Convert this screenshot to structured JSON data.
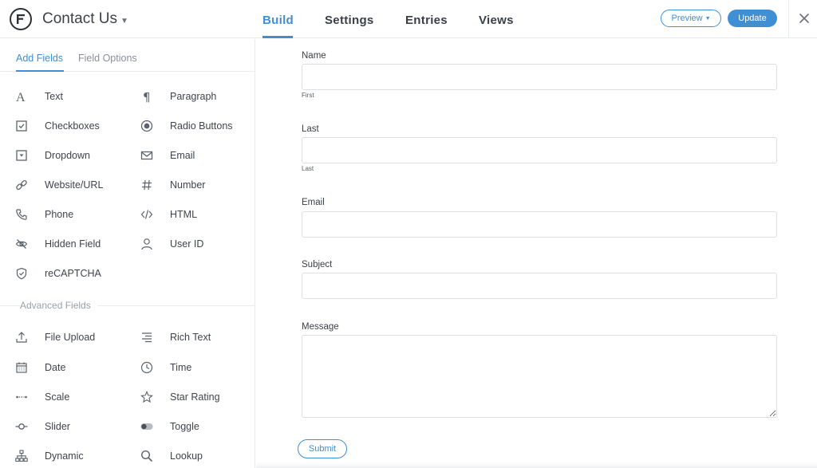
{
  "header": {
    "form_title": "Contact Us",
    "tabs": [
      {
        "label": "Build",
        "active": true
      },
      {
        "label": "Settings",
        "active": false
      },
      {
        "label": "Entries",
        "active": false
      },
      {
        "label": "Views",
        "active": false
      }
    ],
    "preview_label": "Preview",
    "update_label": "Update",
    "accent_color": "#3f8fd4"
  },
  "sidebar": {
    "tabs": [
      {
        "label": "Add Fields",
        "active": true
      },
      {
        "label": "Field Options",
        "active": false
      }
    ],
    "basic_fields": [
      {
        "label": "Text",
        "icon": "text-icon"
      },
      {
        "label": "Paragraph",
        "icon": "paragraph-icon"
      },
      {
        "label": "Checkboxes",
        "icon": "checkbox-icon"
      },
      {
        "label": "Radio Buttons",
        "icon": "radio-icon"
      },
      {
        "label": "Dropdown",
        "icon": "dropdown-icon"
      },
      {
        "label": "Email",
        "icon": "envelope-icon"
      },
      {
        "label": "Website/URL",
        "icon": "link-icon"
      },
      {
        "label": "Number",
        "icon": "hash-icon"
      },
      {
        "label": "Phone",
        "icon": "phone-icon"
      },
      {
        "label": "HTML",
        "icon": "code-icon"
      },
      {
        "label": "Hidden Field",
        "icon": "eye-slash-icon"
      },
      {
        "label": "User ID",
        "icon": "user-icon"
      },
      {
        "label": "reCAPTCHA",
        "icon": "shield-icon"
      }
    ],
    "advanced_section_label": "Advanced Fields",
    "advanced_fields": [
      {
        "label": "File Upload",
        "icon": "upload-icon"
      },
      {
        "label": "Rich Text",
        "icon": "align-right-icon"
      },
      {
        "label": "Date",
        "icon": "calendar-icon"
      },
      {
        "label": "Time",
        "icon": "clock-icon"
      },
      {
        "label": "Scale",
        "icon": "scale-icon"
      },
      {
        "label": "Star Rating",
        "icon": "star-icon"
      },
      {
        "label": "Slider",
        "icon": "slider-icon"
      },
      {
        "label": "Toggle",
        "icon": "toggle-icon"
      },
      {
        "label": "Dynamic",
        "icon": "sitemap-icon"
      },
      {
        "label": "Lookup",
        "icon": "search-icon"
      }
    ]
  },
  "form": {
    "name_label": "Name",
    "first_sublabel": "First",
    "last_label": "Last",
    "last_sublabel": "Last",
    "email_label": "Email",
    "subject_label": "Subject",
    "message_label": "Message",
    "submit_label": "Submit"
  }
}
